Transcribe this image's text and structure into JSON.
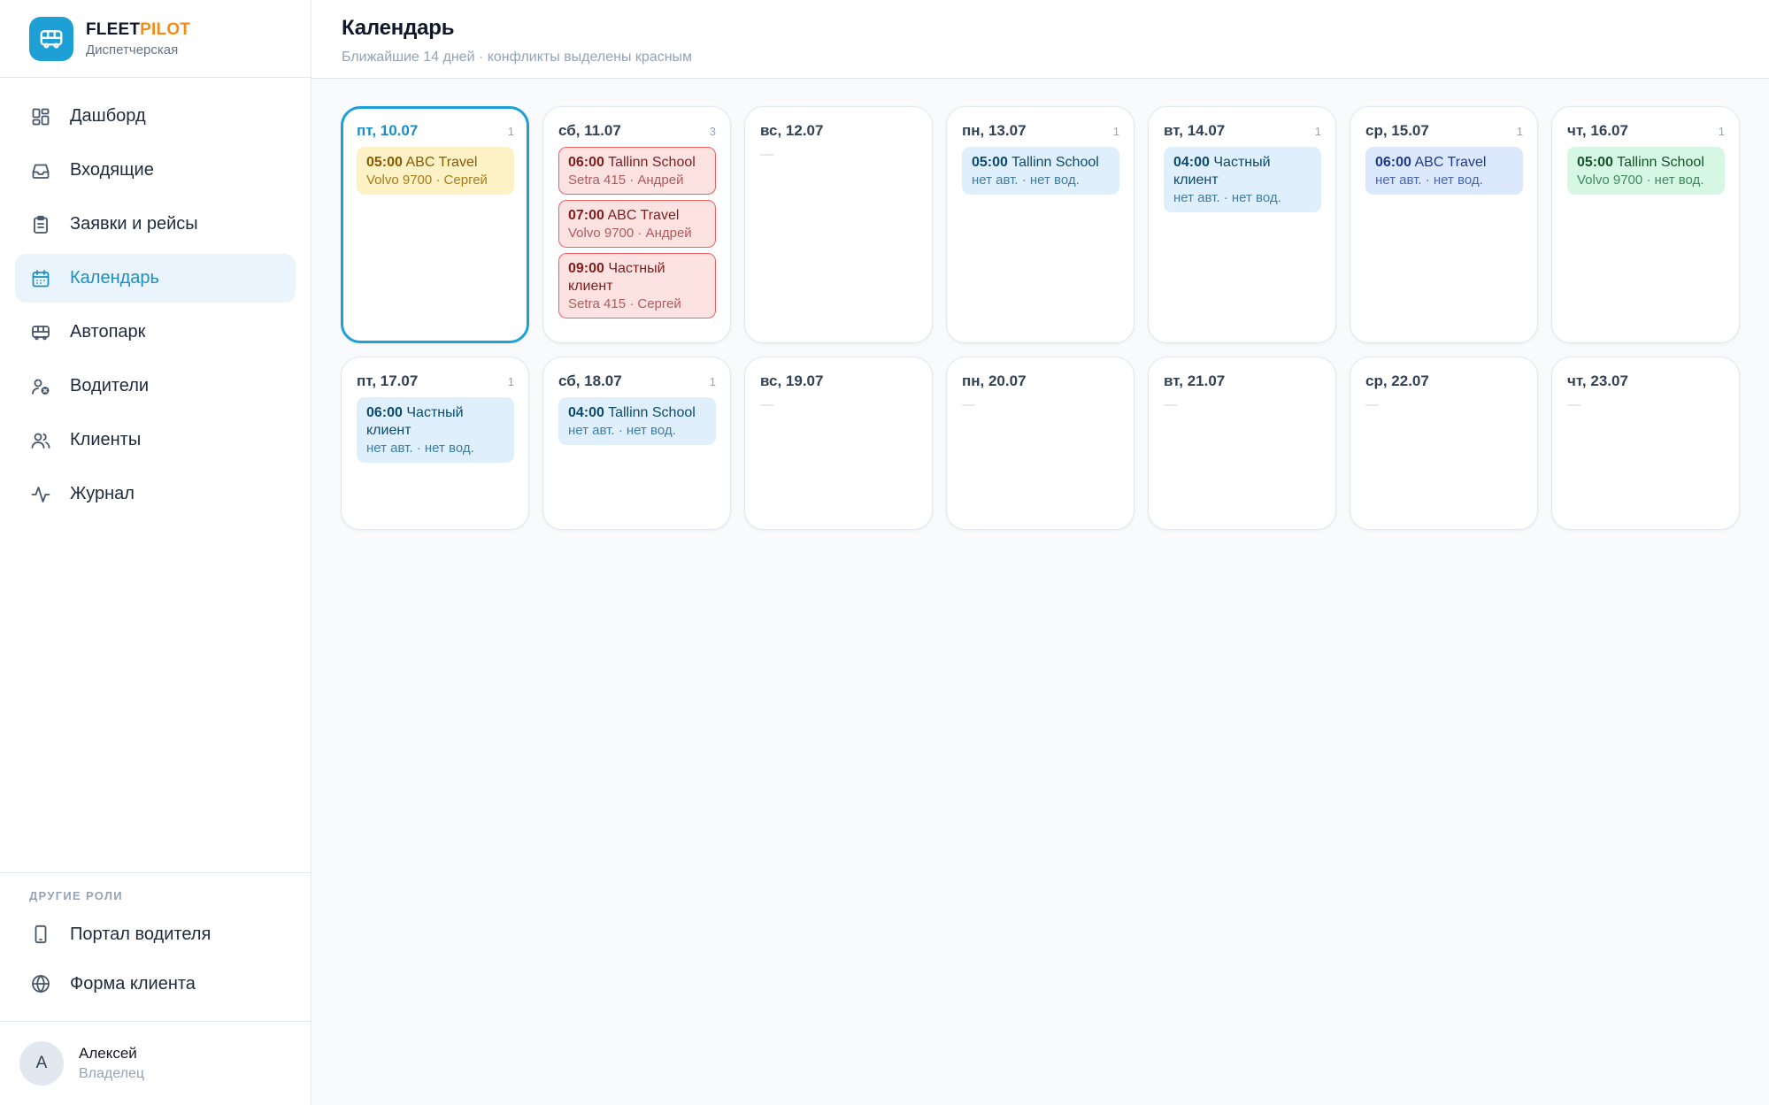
{
  "brand": {
    "name_part1": "FLEET",
    "name_part2": "PILOT",
    "subtitle": "Диспетчерская",
    "icon": "bus-icon"
  },
  "nav": [
    {
      "label": "Дашборд",
      "icon": "dashboard-icon",
      "active": false
    },
    {
      "label": "Входящие",
      "icon": "inbox-icon",
      "active": false
    },
    {
      "label": "Заявки и рейсы",
      "icon": "clipboard-icon",
      "active": false
    },
    {
      "label": "Календарь",
      "icon": "calendar-icon",
      "active": true
    },
    {
      "label": "Автопарк",
      "icon": "bus-icon",
      "active": false
    },
    {
      "label": "Водители",
      "icon": "driver-icon",
      "active": false
    },
    {
      "label": "Клиенты",
      "icon": "users-icon",
      "active": false
    },
    {
      "label": "Журнал",
      "icon": "activity-icon",
      "active": false
    }
  ],
  "other_roles": {
    "title": "ДРУГИЕ РОЛИ",
    "items": [
      {
        "label": "Портал водителя",
        "icon": "phone-icon"
      },
      {
        "label": "Форма клиента",
        "icon": "globe-icon"
      }
    ]
  },
  "user": {
    "initial": "А",
    "name": "Алексей",
    "role": "Владелец"
  },
  "header": {
    "title": "Календарь",
    "subtitle": "Ближайшие 14 дней · конфликты выделены красным"
  },
  "empty_marker": "—",
  "days": [
    {
      "date": "пт, 10.07",
      "count": "1",
      "today": true,
      "events": [
        {
          "time": "05:00",
          "client": "ABC Travel",
          "meta": "Volvo 9700 · Сергей",
          "color": "yellow"
        }
      ]
    },
    {
      "date": "сб, 11.07",
      "count": "3",
      "today": false,
      "events": [
        {
          "time": "06:00",
          "client": "Tallinn School",
          "meta": "Setra 415 · Андрей",
          "color": "red"
        },
        {
          "time": "07:00",
          "client": "ABC Travel",
          "meta": "Volvo 9700 · Андрей",
          "color": "red"
        },
        {
          "time": "09:00",
          "client": "Частный клиент",
          "meta": "Setra 415 · Сергей",
          "color": "red"
        }
      ]
    },
    {
      "date": "вс, 12.07",
      "count": "",
      "today": false,
      "events": []
    },
    {
      "date": "пн, 13.07",
      "count": "1",
      "today": false,
      "events": [
        {
          "time": "05:00",
          "client": "Tallinn School",
          "meta": "нет авт. · нет вод.",
          "color": "sky"
        }
      ]
    },
    {
      "date": "вт, 14.07",
      "count": "1",
      "today": false,
      "events": [
        {
          "time": "04:00",
          "client": "Частный клиент",
          "meta": "нет авт. · нет вод.",
          "color": "sky"
        }
      ]
    },
    {
      "date": "ср, 15.07",
      "count": "1",
      "today": false,
      "events": [
        {
          "time": "06:00",
          "client": "ABC Travel",
          "meta": "нет авт. · нет вод.",
          "color": "blue"
        }
      ]
    },
    {
      "date": "чт, 16.07",
      "count": "1",
      "today": false,
      "events": [
        {
          "time": "05:00",
          "client": "Tallinn School",
          "meta": "Volvo 9700 · нет вод.",
          "color": "green"
        }
      ]
    },
    {
      "date": "пт, 17.07",
      "count": "1",
      "today": false,
      "events": [
        {
          "time": "06:00",
          "client": "Частный клиент",
          "meta": "нет авт. · нет вод.",
          "color": "sky"
        }
      ]
    },
    {
      "date": "сб, 18.07",
      "count": "1",
      "today": false,
      "events": [
        {
          "time": "04:00",
          "client": "Tallinn School",
          "meta": "нет авт. · нет вод.",
          "color": "sky"
        }
      ]
    },
    {
      "date": "вс, 19.07",
      "count": "",
      "today": false,
      "events": []
    },
    {
      "date": "пн, 20.07",
      "count": "",
      "today": false,
      "events": []
    },
    {
      "date": "вт, 21.07",
      "count": "",
      "today": false,
      "events": []
    },
    {
      "date": "ср, 22.07",
      "count": "",
      "today": false,
      "events": []
    },
    {
      "date": "чт, 23.07",
      "count": "",
      "today": false,
      "events": []
    }
  ],
  "colors": {
    "accent": "#1ea0d6",
    "brand_orange": "#f28c16",
    "conflict_red": "#ef5f5f"
  }
}
